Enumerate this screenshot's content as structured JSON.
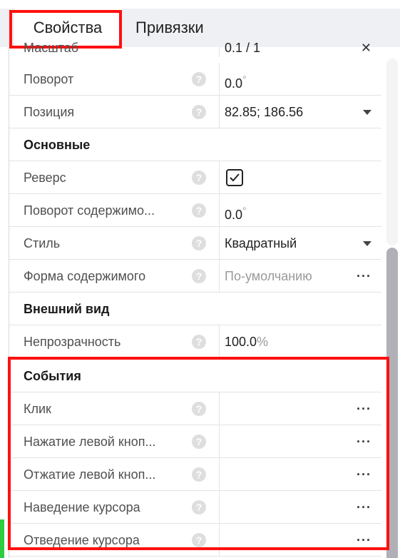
{
  "tabs": [
    {
      "label": "Свойства",
      "active": true
    },
    {
      "label": "Привязки",
      "active": false
    }
  ],
  "rows": {
    "scale_partial": {
      "label": "Масштаб",
      "value": "0.1 / 1"
    },
    "rotation": {
      "label": "Поворот",
      "value": "0.0",
      "unit": "°"
    },
    "position": {
      "label": "Позиция",
      "value": "82.85;  186.56"
    },
    "section_basic": "Основные",
    "reverse": {
      "label": "Реверс",
      "checked": true
    },
    "content_rotation": {
      "label": "Поворот содержимо...",
      "value": "0.0",
      "unit": "°"
    },
    "style": {
      "label": "Стиль",
      "value": "Квадратный"
    },
    "content_shape": {
      "label": "Форма содержимого",
      "value": "По-умолчанию"
    },
    "section_appearance": "Внешний вид",
    "opacity": {
      "label": "Непрозрачность",
      "value": "100.0",
      "unit": "%"
    },
    "section_events": "События",
    "click": {
      "label": "Клик"
    },
    "lmb_down": {
      "label": "Нажатие левой кноп..."
    },
    "lmb_up": {
      "label": "Отжатие левой кноп..."
    },
    "hover": {
      "label": "Наведение курсора"
    },
    "leave": {
      "label": "Отведение курсора"
    }
  },
  "help_glyph": "?",
  "more_glyph": "···",
  "colors": {
    "highlight": "#ff1010",
    "scroll_thumb": "#b0b0b6",
    "tab_strip": "#eef0f3"
  }
}
